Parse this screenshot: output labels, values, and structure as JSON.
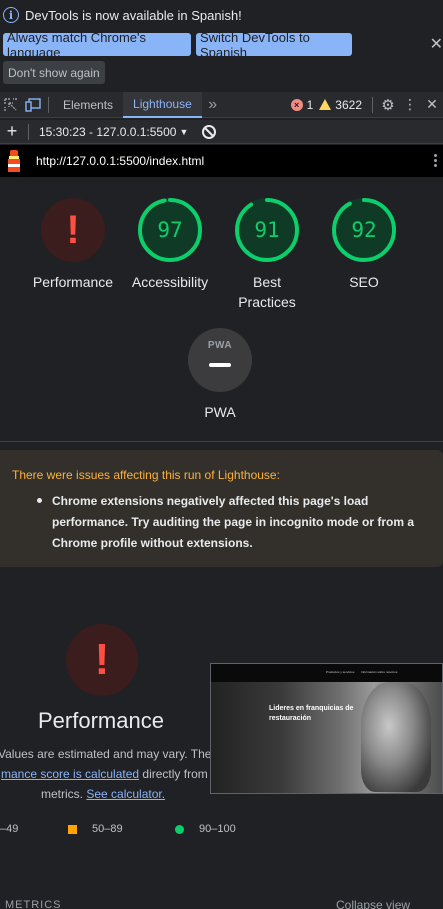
{
  "infobar": {
    "message": "DevTools is now available in Spanish!",
    "btn_match": "Always match Chrome's language",
    "btn_switch": "Switch DevTools to Spanish",
    "btn_dismiss": "Don't show again",
    "close": "✕"
  },
  "toolbar": {
    "tabs": [
      {
        "label": "Elements"
      },
      {
        "label": "Lighthouse"
      }
    ],
    "more": "»",
    "errors": "1",
    "warnings": "3622"
  },
  "report_bar": {
    "add": "+",
    "report_label": "15:30:23 - 127.0.0.1:5500",
    "dropdown": "▼"
  },
  "urlbar": {
    "url": "http://127.0.0.1:5500/index.html"
  },
  "scores": [
    {
      "label": "Performance",
      "score": "!",
      "status": "error"
    },
    {
      "label": "Accessibility",
      "score": "97",
      "value": 97,
      "status": "pass"
    },
    {
      "label": "Best Practices",
      "line1": "Best",
      "line2": "Practices",
      "score": "91",
      "value": 91,
      "status": "pass"
    },
    {
      "label": "SEO",
      "score": "92",
      "value": 92,
      "status": "pass"
    }
  ],
  "pwa": {
    "badge": "PWA",
    "label": "PWA"
  },
  "warning": {
    "title": "There were issues affecting this run of Lighthouse:",
    "items": [
      {
        "line1": "Chrome extensions negatively affected this page's load",
        "line2": "performance. Try auditing the page in incognito mode or from a",
        "line3": "Chrome profile without extensions."
      }
    ]
  },
  "performance": {
    "title": "Performance",
    "desc_1": "Values are estimated and may vary. The",
    "link_score": "mance score is calculated",
    "desc_2": " directly from th",
    "desc_3": "metrics.",
    "link_calc": "See calculator."
  },
  "screenshot": {
    "headline_1": "Lideres en franquicias de",
    "headline_2": "restauración",
    "nav_1": "Productos y servicios",
    "nav_2": "Información sobre nosotros"
  },
  "legend": [
    {
      "label": "–49"
    },
    {
      "label": "50–89"
    },
    {
      "label": "90–100"
    }
  ],
  "metrics": {
    "label": "METRICS",
    "collapse": "Collapse view"
  },
  "colors": {
    "pass": "#0cce6b",
    "average": "#ffa400",
    "fail": "#ff4e42",
    "accent": "#8ab4f8"
  }
}
